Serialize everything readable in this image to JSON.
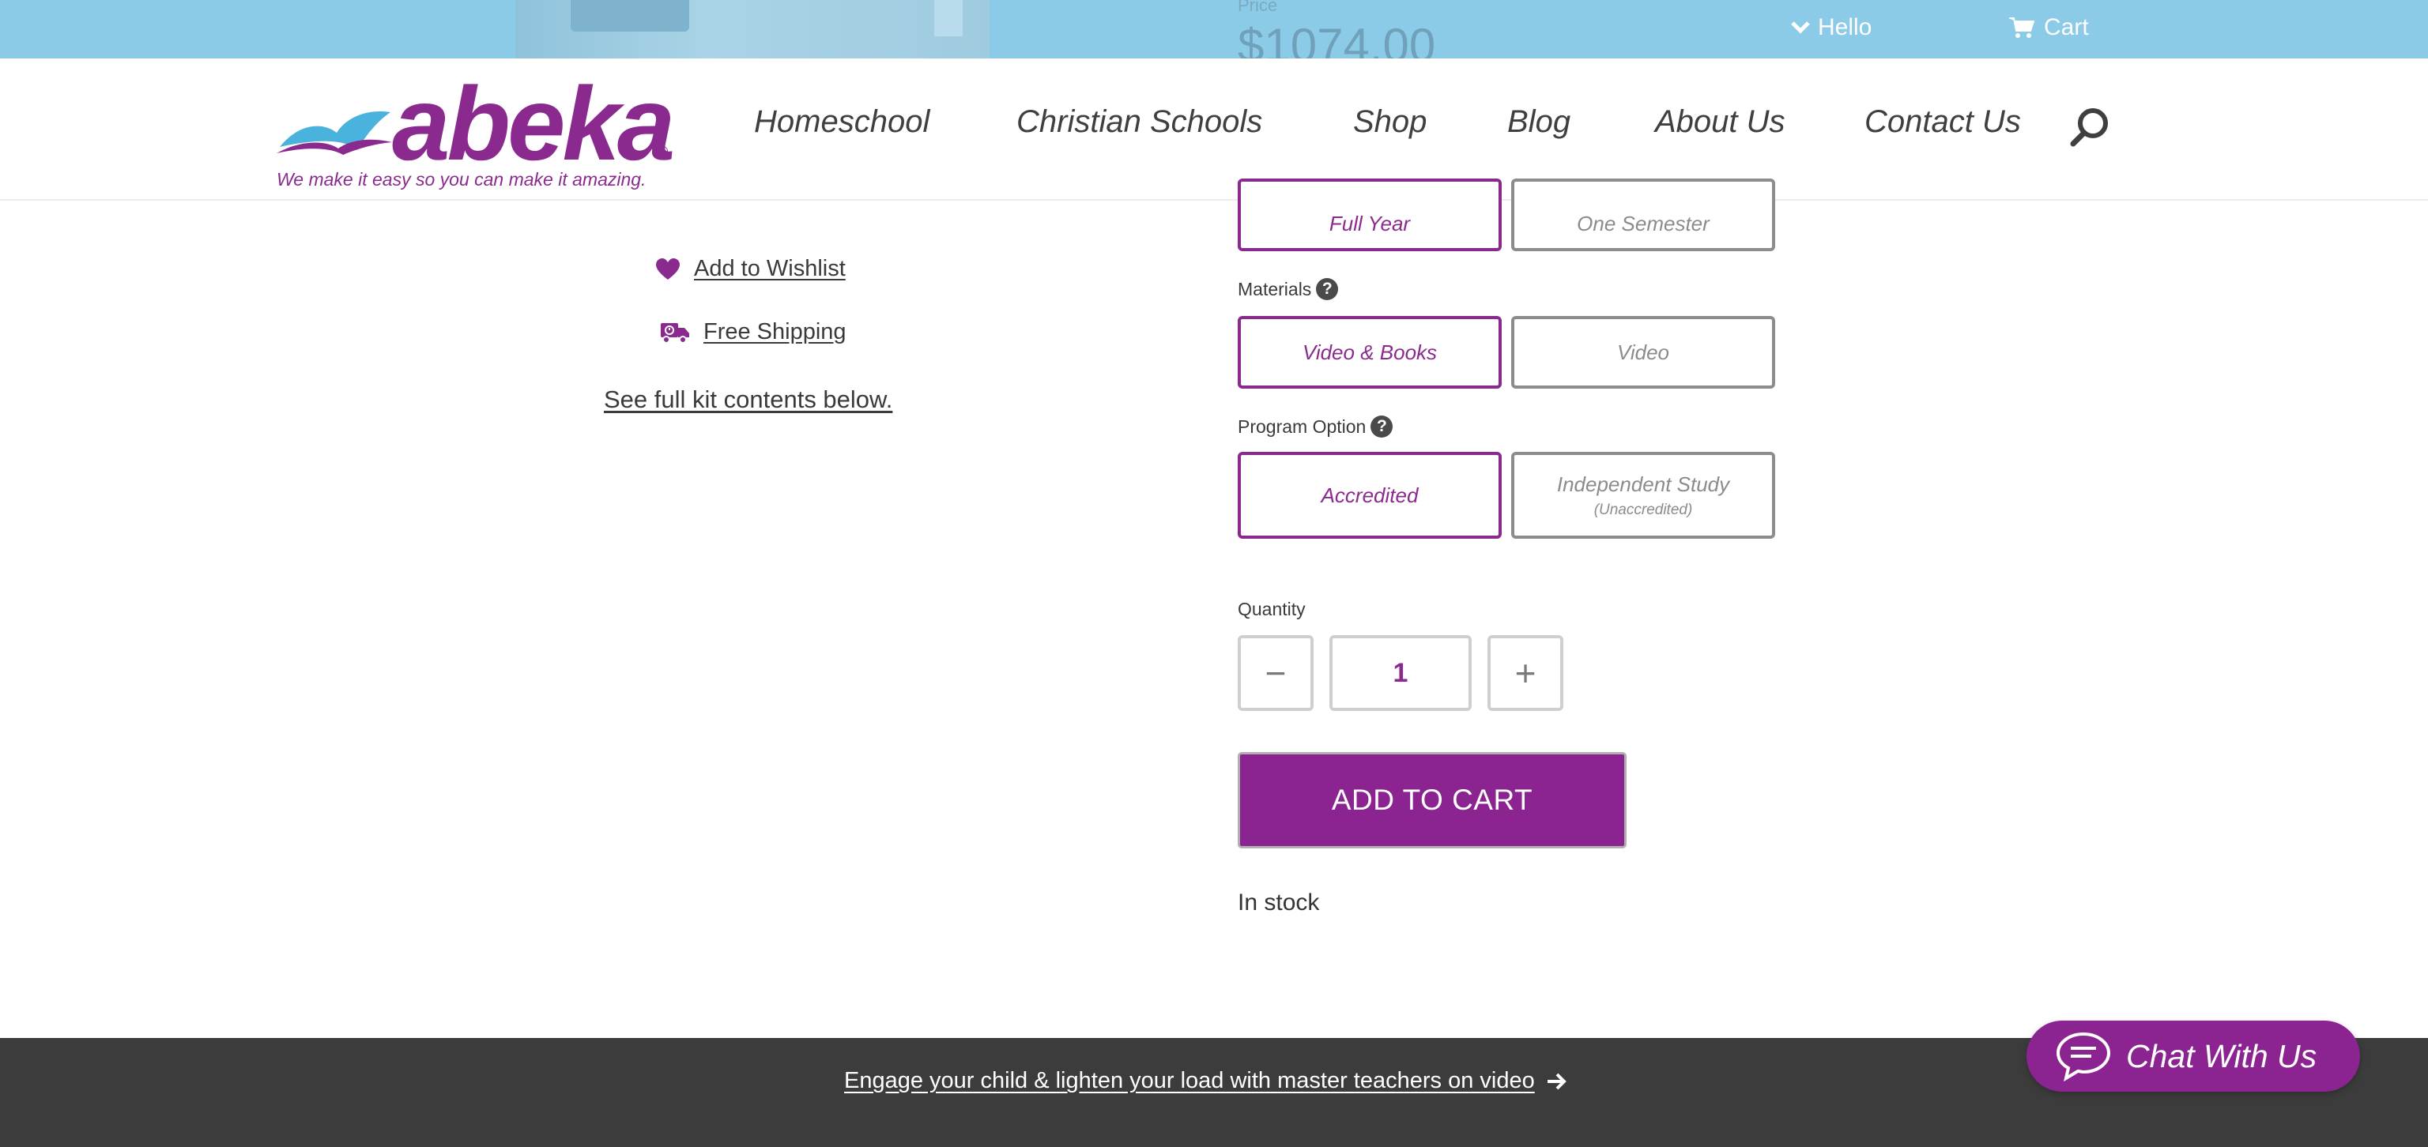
{
  "topbar": {
    "price_label": "Price",
    "price_value": "$1074.00",
    "hello_label": "Hello",
    "cart_label": "Cart"
  },
  "header": {
    "logo_text": "abeka",
    "logo_mark": "®",
    "tagline": "We make it easy so you can make it amazing.",
    "nav": [
      "Homeschool",
      "Christian Schools",
      "Shop",
      "Blog",
      "About Us",
      "Contact Us"
    ]
  },
  "left": {
    "wishlist": "Add to Wishlist",
    "shipping": "Free Shipping",
    "kit_contents": "See full kit contents below."
  },
  "options": {
    "duration": [
      {
        "label": "Full Year",
        "selected": true
      },
      {
        "label": "One Semester",
        "selected": false
      }
    ],
    "materials_label": "Materials",
    "materials": [
      {
        "label": "Video & Books",
        "selected": true
      },
      {
        "label": "Video",
        "selected": false
      }
    ],
    "program_label": "Program Option",
    "program": [
      {
        "label": "Accredited",
        "selected": true
      },
      {
        "label": "Independent Study",
        "sub": "(Unaccredited)",
        "selected": false
      }
    ]
  },
  "quantity": {
    "label": "Quantity",
    "minus": "−",
    "value": "1",
    "plus": "+"
  },
  "add_to_cart": "ADD TO CART",
  "stock_status": "In stock",
  "footer": {
    "banner_link": "Engage your child & lighten your load with master teachers on video"
  },
  "chat": {
    "label": "Chat With Us"
  },
  "colors": {
    "brand_purple": "#8b2a8e",
    "topbar_blue": "#8ccbe8",
    "footer_dark": "#3c3c3c"
  }
}
